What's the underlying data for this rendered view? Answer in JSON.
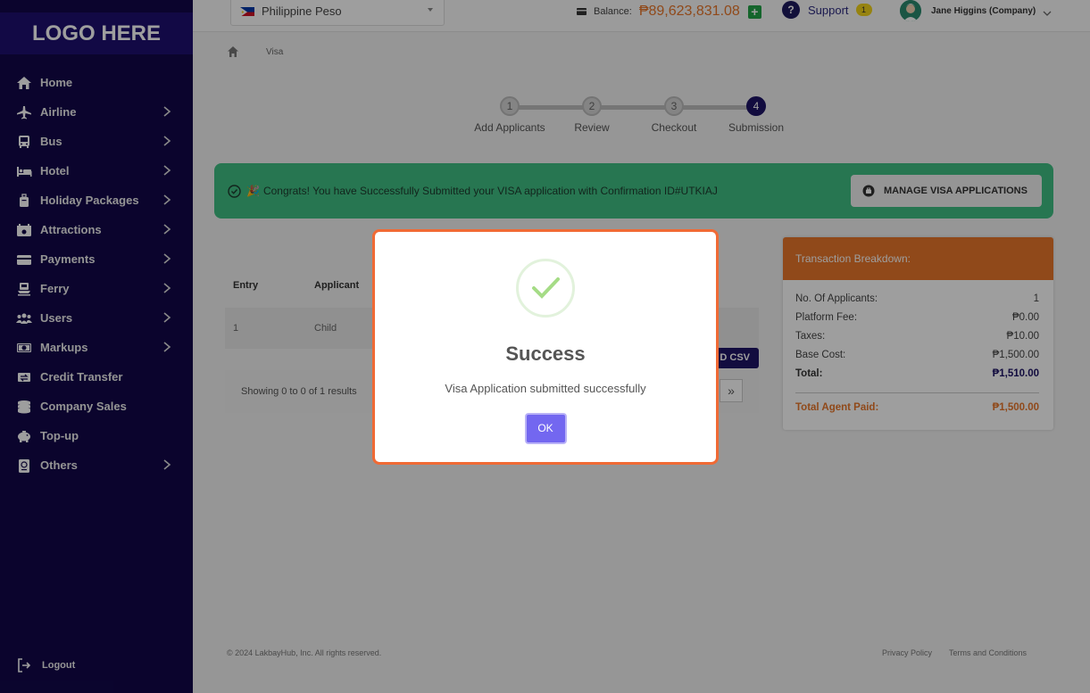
{
  "sidebar": {
    "logo": "LOGO HERE",
    "items": [
      {
        "label": "Home",
        "icon": "home-icon"
      },
      {
        "label": "Airline",
        "icon": "plane-icon"
      },
      {
        "label": "Bus",
        "icon": "bus-icon"
      },
      {
        "label": "Hotel",
        "icon": "bed-icon"
      },
      {
        "label": "Holiday Packages",
        "icon": "suitcase-icon"
      },
      {
        "label": "Attractions",
        "icon": "ticket-icon"
      },
      {
        "label": "Payments",
        "icon": "credit-card-icon"
      },
      {
        "label": "Ferry",
        "icon": "ferry-icon"
      },
      {
        "label": "Users",
        "icon": "users-icon"
      },
      {
        "label": "Markups",
        "icon": "money-icon"
      },
      {
        "label": "Credit Transfer",
        "icon": "transfer-icon"
      },
      {
        "label": "Company Sales",
        "icon": "coins-icon"
      },
      {
        "label": "Top-up",
        "icon": "piggy-bank-icon"
      },
      {
        "label": "Others",
        "icon": "passport-icon"
      }
    ],
    "logout": "Logout"
  },
  "topbar": {
    "currency": "Philippine Peso",
    "balance_label": "Balance:",
    "balance_value": "₱89,623,831.08",
    "support_label": "Support",
    "support_badge": "1",
    "user_name": "Jane Higgins (Company)"
  },
  "breadcrumb": {
    "current": "Visa"
  },
  "stepper": {
    "steps": [
      {
        "num": "1",
        "label": "Add Applicants"
      },
      {
        "num": "2",
        "label": "Review"
      },
      {
        "num": "3",
        "label": "Checkout"
      },
      {
        "num": "4",
        "label": "Submission"
      }
    ]
  },
  "banner": {
    "message": "Congrats! You have Successfully Submitted your VISA application with Confirmation ID#UTKIAJ",
    "button": "MANAGE VISA APPLICATIONS"
  },
  "table": {
    "headers": [
      "Entry",
      "Applicant"
    ],
    "rows": [
      [
        "1",
        "Child"
      ]
    ],
    "csv_button": "D CSV",
    "showing": "Showing 0 to 0 of 1 results",
    "pager_next": "»"
  },
  "breakdown": {
    "title": "Transaction Breakdown:",
    "rows": [
      {
        "label": "No. Of Applicants:",
        "value": "1"
      },
      {
        "label": "Platform Fee:",
        "value": "₱0.00"
      },
      {
        "label": "Taxes:",
        "value": "₱10.00"
      },
      {
        "label": "Base Cost:",
        "value": "₱1,500.00"
      }
    ],
    "total_label": "Total:",
    "total_value": "₱1,510.00",
    "paid_label": "Total Agent Paid:",
    "paid_value": "₱1,500.00"
  },
  "footer": {
    "copyright": "© 2024 LakbayHub, Inc. All rights reserved.",
    "privacy": "Privacy Policy",
    "terms": "Terms and Conditions"
  },
  "modal": {
    "title": "Success",
    "message": "Visa Application submitted successfully",
    "ok": "OK"
  },
  "colors": {
    "sidebar": "#12084a",
    "accent_orange": "#e8772a",
    "banner_green": "#3fbf83",
    "primary_navy": "#1d1466",
    "modal_button": "#7367f0"
  }
}
